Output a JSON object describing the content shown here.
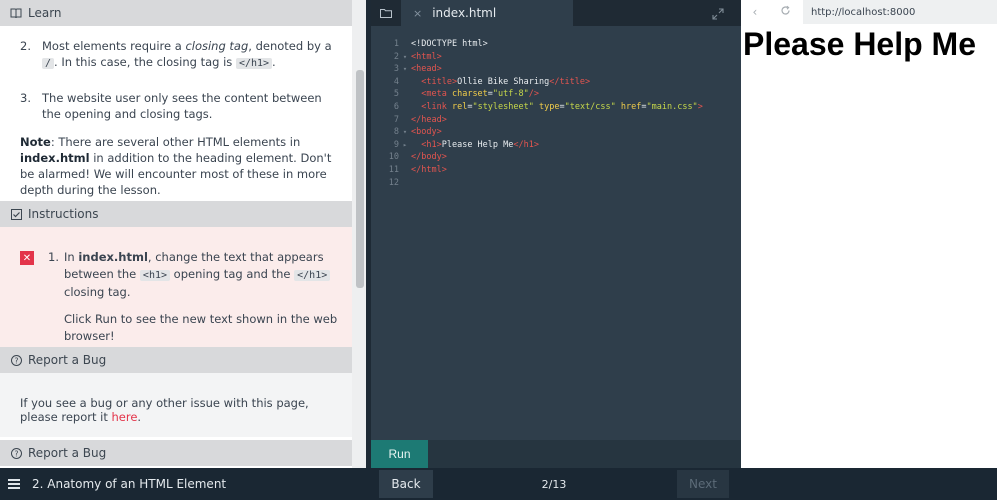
{
  "learn": {
    "header": "Learn",
    "item2": {
      "num": "2.",
      "t1": "Most elements require a ",
      "em": "closing tag",
      "t2": ", denoted by a ",
      "code1": "/",
      "t3": ". In this case, the closing tag is ",
      "code2": "</h1>",
      "t4": "."
    },
    "item3": {
      "num": "3.",
      "text": "The website user only sees the content between the opening and closing tags."
    },
    "note": {
      "label": "Note",
      "t1": ": There are several other HTML elements in ",
      "bold": "index.html",
      "t2": " in addition to the heading element. Don't be alarmed! We will encounter most of these in more depth during the lesson."
    }
  },
  "instructions": {
    "header": "Instructions",
    "status_icon": "x-fail-icon",
    "item": {
      "num": "1.",
      "t1": "In ",
      "bold": "index.html",
      "t2": ", change the text that appears between the ",
      "code1": "<h1>",
      "t3": " opening tag and the ",
      "code2": "</h1>",
      "t4": " closing tag.",
      "p2": "Click Run to see the new text shown in the web browser!"
    }
  },
  "bug": {
    "header": "Report a Bug",
    "t1": "If you see a bug or any other issue with this page, please report it ",
    "link": "here",
    "t2": ".",
    "header2": "Report a Bug"
  },
  "editor": {
    "tab_close": "×",
    "tab": "index.html",
    "lines": {
      "l1": "<!DOCTYPE html>",
      "l2": "<html>",
      "l3": "<head>",
      "l4a": "<title>",
      "l4b": "Ollie Bike Sharing",
      "l4c": "</title>",
      "l5a": "<meta ",
      "l5b": "charset",
      "l5c": "=",
      "l5d": "\"utf-8\"",
      "l5e": "/>",
      "l6a": "<link ",
      "l6b": "rel",
      "l6c": "=",
      "l6d": "\"stylesheet\"",
      "l6e": " type",
      "l6f": "=",
      "l6g": "\"text/css\"",
      "l6h": " href",
      "l6i": "=",
      "l6j": "\"main.css\"",
      "l6k": ">",
      "l7": "</head>",
      "l8": "<body>",
      "l9a": "<h1>",
      "l9b": "Please Help Me",
      "l9c": "</h1>",
      "l10": "</body>",
      "l11": "</html>"
    },
    "run": "Run"
  },
  "browser": {
    "url": "http://localhost:8000",
    "heading": "Please Help Me"
  },
  "footer": {
    "course": "2. Anatomy of an HTML Element",
    "back": "Back",
    "progress": "2/13",
    "next": "Next"
  },
  "colors": {
    "tag": "#e3554f",
    "attr": "#f0cc4a",
    "string": "#c6d74a",
    "run": "#1d7a74",
    "fail": "#e3344a"
  }
}
